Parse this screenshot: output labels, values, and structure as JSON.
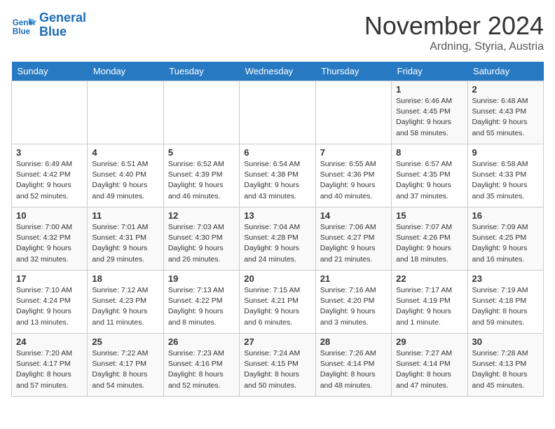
{
  "header": {
    "logo_line1": "General",
    "logo_line2": "Blue",
    "month": "November 2024",
    "location": "Ardning, Styria, Austria"
  },
  "weekdays": [
    "Sunday",
    "Monday",
    "Tuesday",
    "Wednesday",
    "Thursday",
    "Friday",
    "Saturday"
  ],
  "weeks": [
    [
      {
        "day": "",
        "info": ""
      },
      {
        "day": "",
        "info": ""
      },
      {
        "day": "",
        "info": ""
      },
      {
        "day": "",
        "info": ""
      },
      {
        "day": "",
        "info": ""
      },
      {
        "day": "1",
        "info": "Sunrise: 6:46 AM\nSunset: 4:45 PM\nDaylight: 9 hours\nand 58 minutes."
      },
      {
        "day": "2",
        "info": "Sunrise: 6:48 AM\nSunset: 4:43 PM\nDaylight: 9 hours\nand 55 minutes."
      }
    ],
    [
      {
        "day": "3",
        "info": "Sunrise: 6:49 AM\nSunset: 4:42 PM\nDaylight: 9 hours\nand 52 minutes."
      },
      {
        "day": "4",
        "info": "Sunrise: 6:51 AM\nSunset: 4:40 PM\nDaylight: 9 hours\nand 49 minutes."
      },
      {
        "day": "5",
        "info": "Sunrise: 6:52 AM\nSunset: 4:39 PM\nDaylight: 9 hours\nand 46 minutes."
      },
      {
        "day": "6",
        "info": "Sunrise: 6:54 AM\nSunset: 4:38 PM\nDaylight: 9 hours\nand 43 minutes."
      },
      {
        "day": "7",
        "info": "Sunrise: 6:55 AM\nSunset: 4:36 PM\nDaylight: 9 hours\nand 40 minutes."
      },
      {
        "day": "8",
        "info": "Sunrise: 6:57 AM\nSunset: 4:35 PM\nDaylight: 9 hours\nand 37 minutes."
      },
      {
        "day": "9",
        "info": "Sunrise: 6:58 AM\nSunset: 4:33 PM\nDaylight: 9 hours\nand 35 minutes."
      }
    ],
    [
      {
        "day": "10",
        "info": "Sunrise: 7:00 AM\nSunset: 4:32 PM\nDaylight: 9 hours\nand 32 minutes."
      },
      {
        "day": "11",
        "info": "Sunrise: 7:01 AM\nSunset: 4:31 PM\nDaylight: 9 hours\nand 29 minutes."
      },
      {
        "day": "12",
        "info": "Sunrise: 7:03 AM\nSunset: 4:30 PM\nDaylight: 9 hours\nand 26 minutes."
      },
      {
        "day": "13",
        "info": "Sunrise: 7:04 AM\nSunset: 4:28 PM\nDaylight: 9 hours\nand 24 minutes."
      },
      {
        "day": "14",
        "info": "Sunrise: 7:06 AM\nSunset: 4:27 PM\nDaylight: 9 hours\nand 21 minutes."
      },
      {
        "day": "15",
        "info": "Sunrise: 7:07 AM\nSunset: 4:26 PM\nDaylight: 9 hours\nand 18 minutes."
      },
      {
        "day": "16",
        "info": "Sunrise: 7:09 AM\nSunset: 4:25 PM\nDaylight: 9 hours\nand 16 minutes."
      }
    ],
    [
      {
        "day": "17",
        "info": "Sunrise: 7:10 AM\nSunset: 4:24 PM\nDaylight: 9 hours\nand 13 minutes."
      },
      {
        "day": "18",
        "info": "Sunrise: 7:12 AM\nSunset: 4:23 PM\nDaylight: 9 hours\nand 11 minutes."
      },
      {
        "day": "19",
        "info": "Sunrise: 7:13 AM\nSunset: 4:22 PM\nDaylight: 9 hours\nand 8 minutes."
      },
      {
        "day": "20",
        "info": "Sunrise: 7:15 AM\nSunset: 4:21 PM\nDaylight: 9 hours\nand 6 minutes."
      },
      {
        "day": "21",
        "info": "Sunrise: 7:16 AM\nSunset: 4:20 PM\nDaylight: 9 hours\nand 3 minutes."
      },
      {
        "day": "22",
        "info": "Sunrise: 7:17 AM\nSunset: 4:19 PM\nDaylight: 9 hours\nand 1 minute."
      },
      {
        "day": "23",
        "info": "Sunrise: 7:19 AM\nSunset: 4:18 PM\nDaylight: 8 hours\nand 59 minutes."
      }
    ],
    [
      {
        "day": "24",
        "info": "Sunrise: 7:20 AM\nSunset: 4:17 PM\nDaylight: 8 hours\nand 57 minutes."
      },
      {
        "day": "25",
        "info": "Sunrise: 7:22 AM\nSunset: 4:17 PM\nDaylight: 8 hours\nand 54 minutes."
      },
      {
        "day": "26",
        "info": "Sunrise: 7:23 AM\nSunset: 4:16 PM\nDaylight: 8 hours\nand 52 minutes."
      },
      {
        "day": "27",
        "info": "Sunrise: 7:24 AM\nSunset: 4:15 PM\nDaylight: 8 hours\nand 50 minutes."
      },
      {
        "day": "28",
        "info": "Sunrise: 7:26 AM\nSunset: 4:14 PM\nDaylight: 8 hours\nand 48 minutes."
      },
      {
        "day": "29",
        "info": "Sunrise: 7:27 AM\nSunset: 4:14 PM\nDaylight: 8 hours\nand 47 minutes."
      },
      {
        "day": "30",
        "info": "Sunrise: 7:28 AM\nSunset: 4:13 PM\nDaylight: 8 hours\nand 45 minutes."
      }
    ]
  ]
}
